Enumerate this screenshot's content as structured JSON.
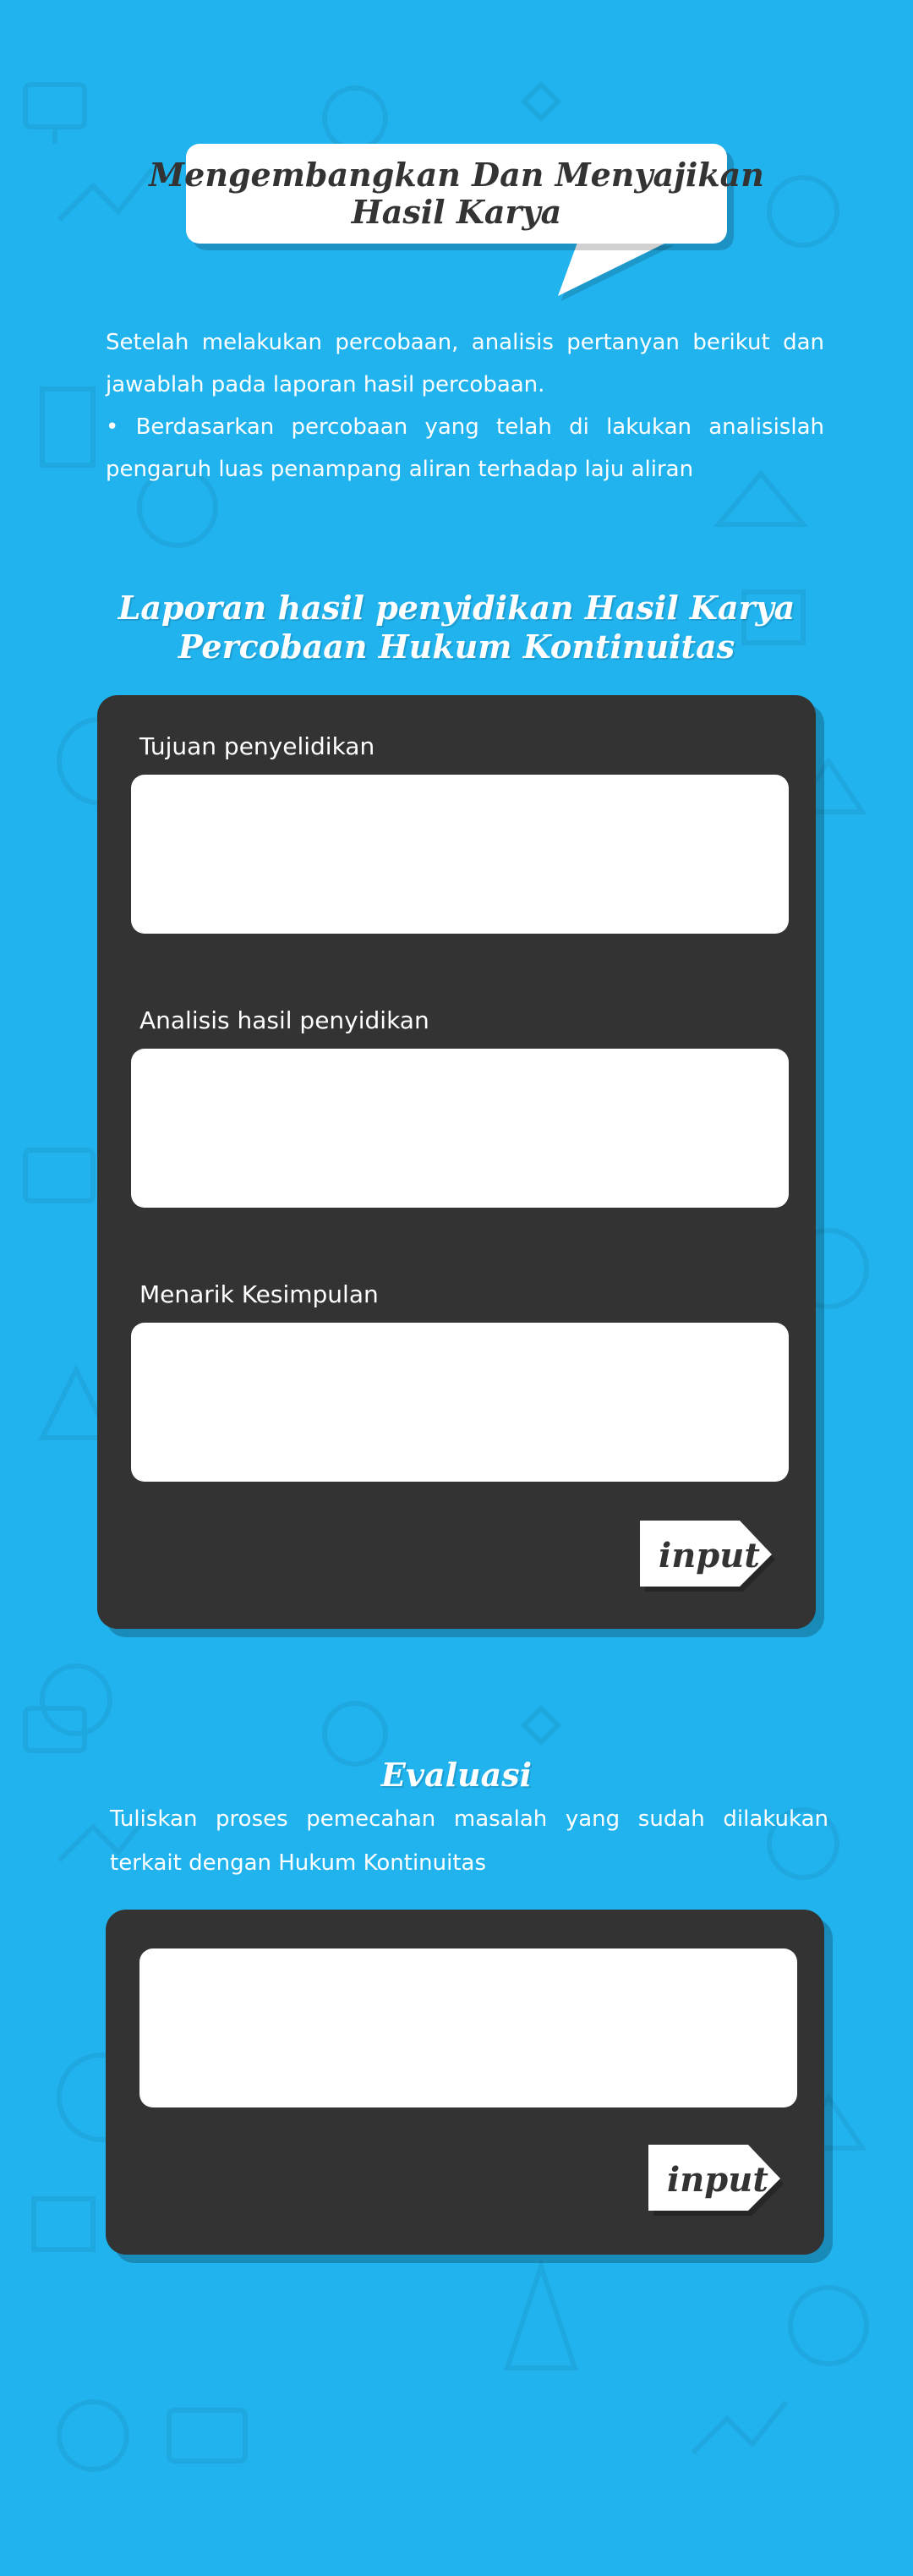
{
  "header": {
    "title_line1": "Mengembangkan Dan Menyajikan",
    "title_line2": "Hasil  Karya"
  },
  "intro": {
    "paragraph1": "Setelah melakukan percobaan, analisis pertanyan berikut dan jawablah pada laporan hasil percobaan.",
    "paragraph2": "•  Berdasarkan percobaan yang telah di  lakukan analisislah pengaruh luas penampang aliran terhadap laju aliran"
  },
  "report": {
    "heading_line1": "Laporan hasil penyidikan Hasil Karya",
    "heading_line2": "Percobaan Hukum Kontinuitas",
    "fields": [
      {
        "label": "Tujuan penyelidikan",
        "value": ""
      },
      {
        "label": "Analisis hasil penyidikan",
        "value": ""
      },
      {
        "label": "Menarik Kesimpulan",
        "value": ""
      }
    ],
    "submit_label": "input"
  },
  "evaluation": {
    "heading": "Evaluasi",
    "instruction": "Tuliskan proses pemecahan masalah yang sudah dilakukan terkait dengan Hukum Kontinuitas",
    "value": "",
    "submit_label": "input"
  },
  "colors": {
    "background": "#21b3ee",
    "panel": "#333333",
    "field": "#ffffff",
    "text_dark": "#333333"
  }
}
